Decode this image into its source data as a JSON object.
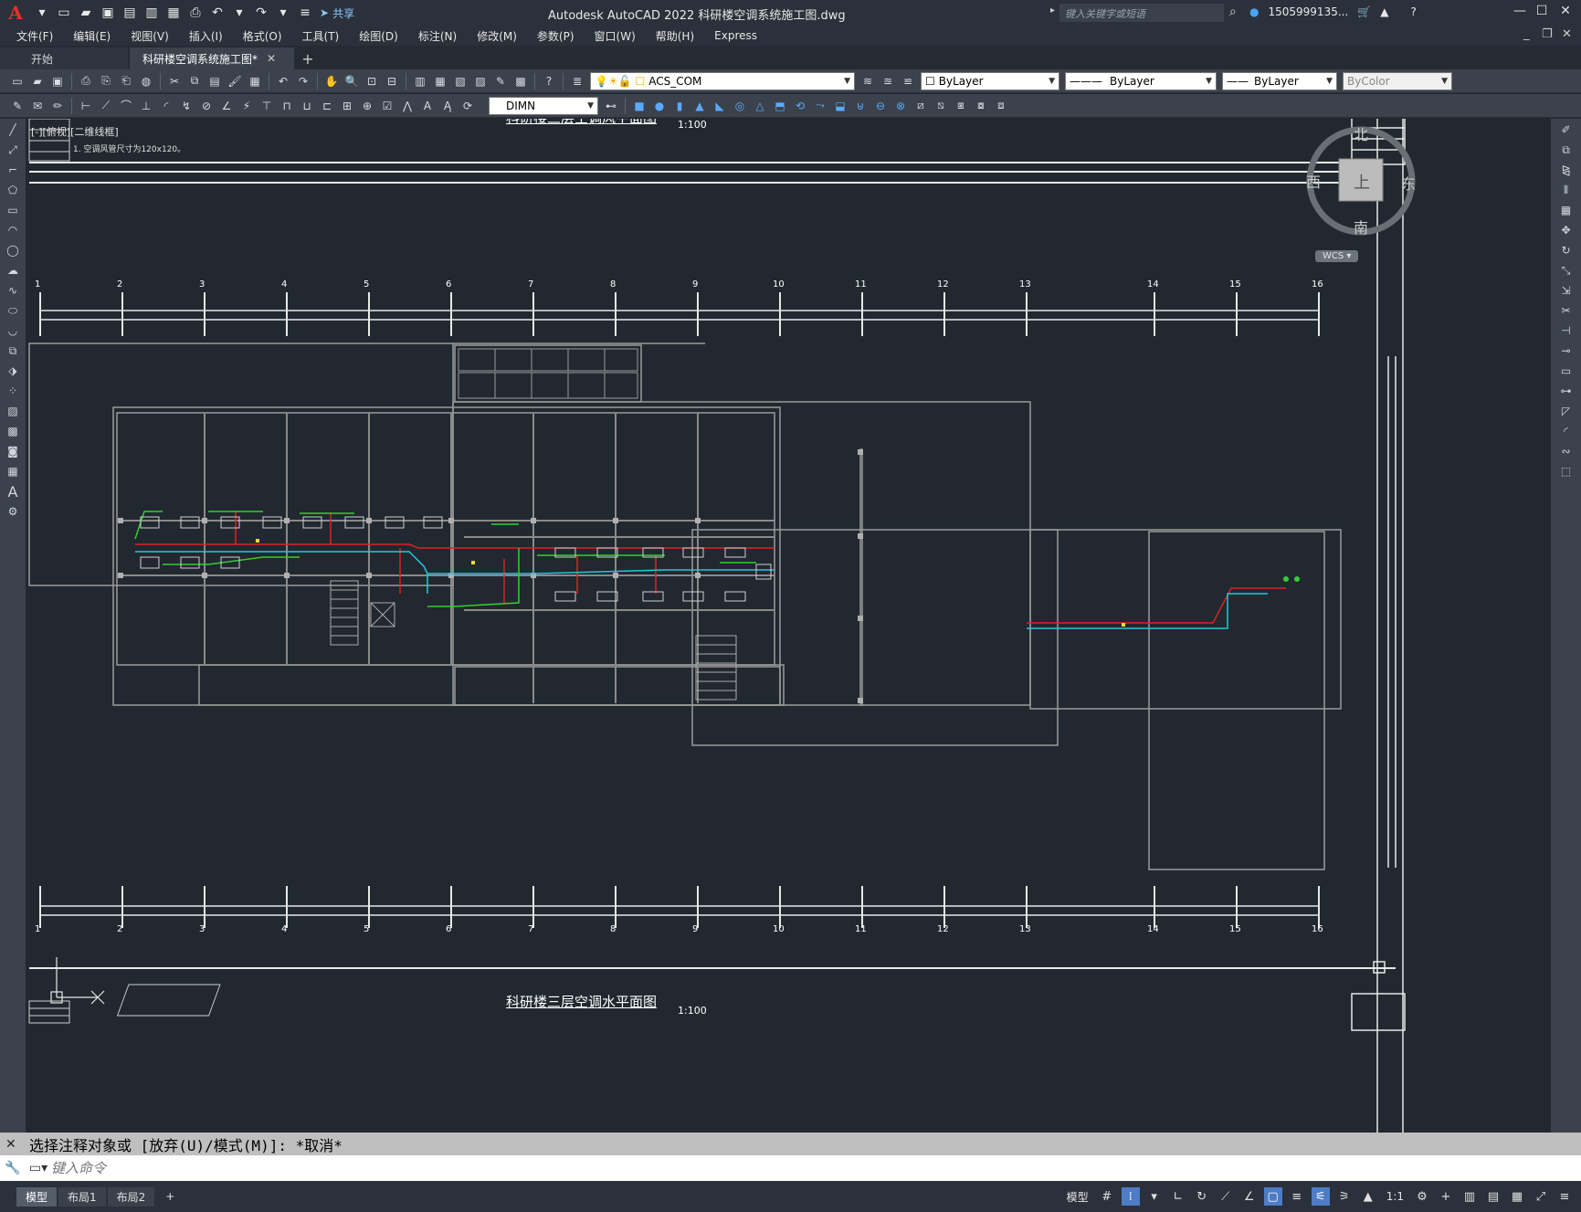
{
  "app": {
    "logo": "A",
    "title": "Autodesk AutoCAD 2022    科研楼空调系统施工图.dwg",
    "share_label": "共享",
    "search_placeholder": "键入关键字或短语",
    "user_name": "1505999135..."
  },
  "menu": [
    "文件(F)",
    "编辑(E)",
    "视图(V)",
    "插入(I)",
    "格式(O)",
    "工具(T)",
    "绘图(D)",
    "标注(N)",
    "修改(M)",
    "参数(P)",
    "窗口(W)",
    "帮助(H)",
    "Express"
  ],
  "doc_tabs": [
    {
      "label": "开始",
      "active": false
    },
    {
      "label": "科研楼空调系统施工图*",
      "active": true
    }
  ],
  "toolbar1": {
    "layer_name": "ACS_COM",
    "color": "ByLayer",
    "linetype": "ByLayer",
    "lineweight": "ByLayer",
    "plotstyle": "ByColor"
  },
  "toolbar2": {
    "dim_style": "DIMN"
  },
  "canvas": {
    "viewport_label": "[-][俯视][二维线框]",
    "title_top": "科研楼三层空调风平面图",
    "scale_top": "1:100",
    "title_bottom": "科研楼三层空调水平面图",
    "scale_bottom": "1:100",
    "note_text": "1. 空调风管尺寸为120x120。",
    "axis_numbers": [
      "1",
      "2",
      "3",
      "4",
      "5",
      "6",
      "7",
      "8",
      "9",
      "10",
      "11",
      "12",
      "13",
      "14",
      "15",
      "16"
    ]
  },
  "viewcube": {
    "north": "北",
    "south": "南",
    "east": "东",
    "west": "西",
    "face": "上",
    "wcs": "WCS"
  },
  "command": {
    "history": "选择注释对象或 [放弃(U)/模式(M)]: *取消*",
    "placeholder": "键入命令"
  },
  "statusbar": {
    "layouts": [
      {
        "label": "模型",
        "active": true
      },
      {
        "label": "布局1",
        "active": false
      },
      {
        "label": "布局2",
        "active": false
      }
    ],
    "model_label": "模型",
    "annotation_scale": "1:1"
  }
}
